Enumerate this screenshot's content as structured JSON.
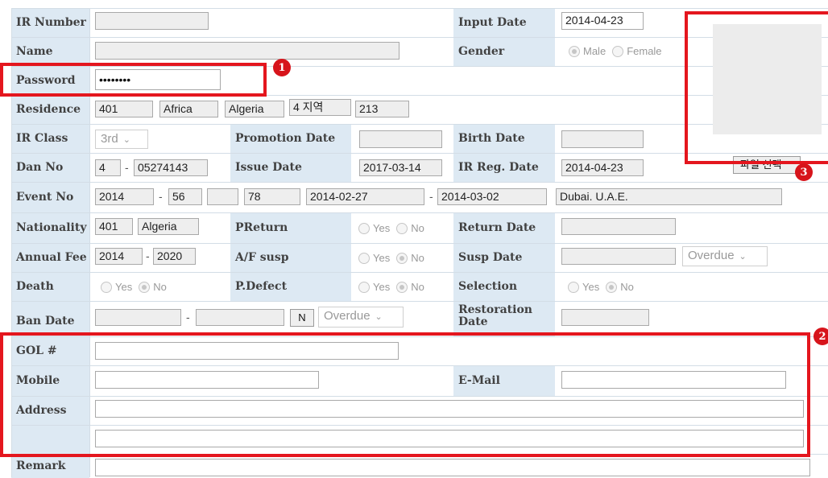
{
  "labels": {
    "ir_number": "IR Number",
    "input_date": "Input Date",
    "name": "Name",
    "gender": "Gender",
    "password": "Password",
    "residence": "Residence",
    "ir_class": "IR Class",
    "promotion_date": "Promotion Date",
    "birth_date": "Birth Date",
    "dan_no": "Dan No",
    "issue_date": "Issue Date",
    "ir_reg_date": "IR Reg. Date",
    "event_no": "Event No",
    "nationality": "Nationality",
    "preturn": "PReturn",
    "return_date": "Return Date",
    "annual_fee": "Annual Fee",
    "af_susp": "A/F susp",
    "susp_date": "Susp Date",
    "death": "Death",
    "p_defect": "P.Defect",
    "selection": "Selection",
    "ban_date": "Ban Date",
    "restoration_date": "Restoration Date",
    "gol": "GOL #",
    "mobile": "Mobile",
    "email": "E-Mail",
    "address": "Address",
    "remark": "Remark"
  },
  "values": {
    "ir_number": "",
    "input_date": "2014-04-23",
    "name": "",
    "password": "••••••••",
    "residence": [
      "401",
      "Africa",
      "Algeria",
      "4 지역",
      "213"
    ],
    "ir_class": "3rd",
    "promotion_date": "",
    "birth_date": "",
    "dan_no": [
      "4",
      "05274143"
    ],
    "issue_date": "2017-03-14",
    "ir_reg_date": "2014-04-23",
    "event_no": [
      "2014",
      "56",
      "",
      "78",
      "2014-02-27",
      "2014-03-02",
      "Dubai. U.A.E."
    ],
    "nationality": [
      "401",
      "Algeria"
    ],
    "return_date": "",
    "annual_fee": [
      "2014",
      "2020"
    ],
    "susp_date": "",
    "susp_select": "Overdue",
    "ban_date": [
      "",
      ""
    ],
    "ban_flag": "N",
    "ban_select": "Overdue",
    "restoration_date": "",
    "gol": "",
    "mobile": "",
    "email": "",
    "address1": "",
    "address2": "",
    "remark": ""
  },
  "radios": {
    "gender": [
      "Male",
      "Female"
    ],
    "yes": "Yes",
    "no": "No"
  },
  "file_button": "파일 선택",
  "dash": "-",
  "badges": [
    "1",
    "2",
    "3"
  ],
  "colors": {
    "label_bg": "#dde9f3",
    "annotation_red": "#e4161e"
  }
}
